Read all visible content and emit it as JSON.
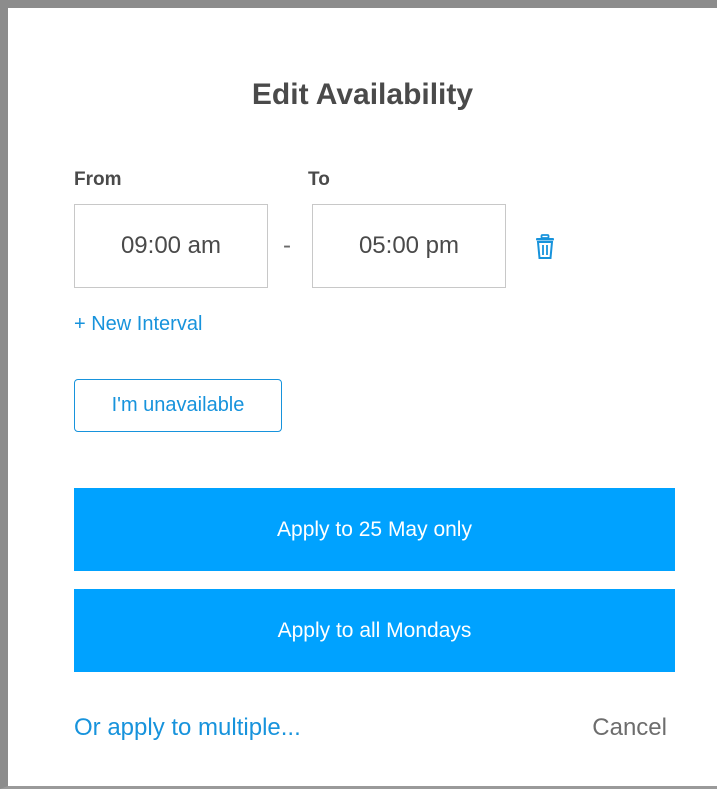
{
  "dialog": {
    "title": "Edit Availability"
  },
  "interval": {
    "from_label": "From",
    "to_label": "To",
    "from_value": "09:00 am",
    "separator": "-",
    "to_value": "05:00 pm",
    "delete_icon": "trash-icon"
  },
  "actions": {
    "new_interval": "+ New Interval",
    "unavailable": "I'm unavailable",
    "apply_date": "Apply to 25 May only",
    "apply_weekday": "Apply to all Mondays",
    "apply_multiple": "Or apply to multiple...",
    "cancel": "Cancel"
  },
  "colors": {
    "accent": "#1793dc",
    "primary_button": "#00a2ff",
    "title_text": "#4a4a4a"
  }
}
